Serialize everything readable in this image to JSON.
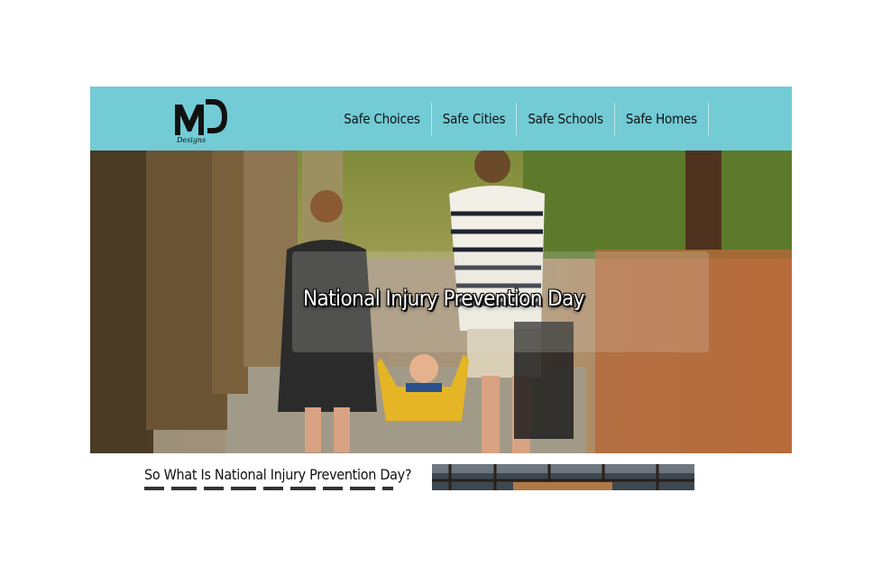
{
  "header": {
    "logo_text": "MD",
    "logo_subtext": "Designs",
    "accent_color": "#72cbd5"
  },
  "nav": {
    "items": [
      {
        "label": "Safe Choices"
      },
      {
        "label": "Safe Cities"
      },
      {
        "label": "Safe Schools"
      },
      {
        "label": "Safe Homes"
      }
    ]
  },
  "hero": {
    "title": "National Injury Prevention Day"
  },
  "article": {
    "title": "So What Is National Injury Prevention Day?"
  }
}
